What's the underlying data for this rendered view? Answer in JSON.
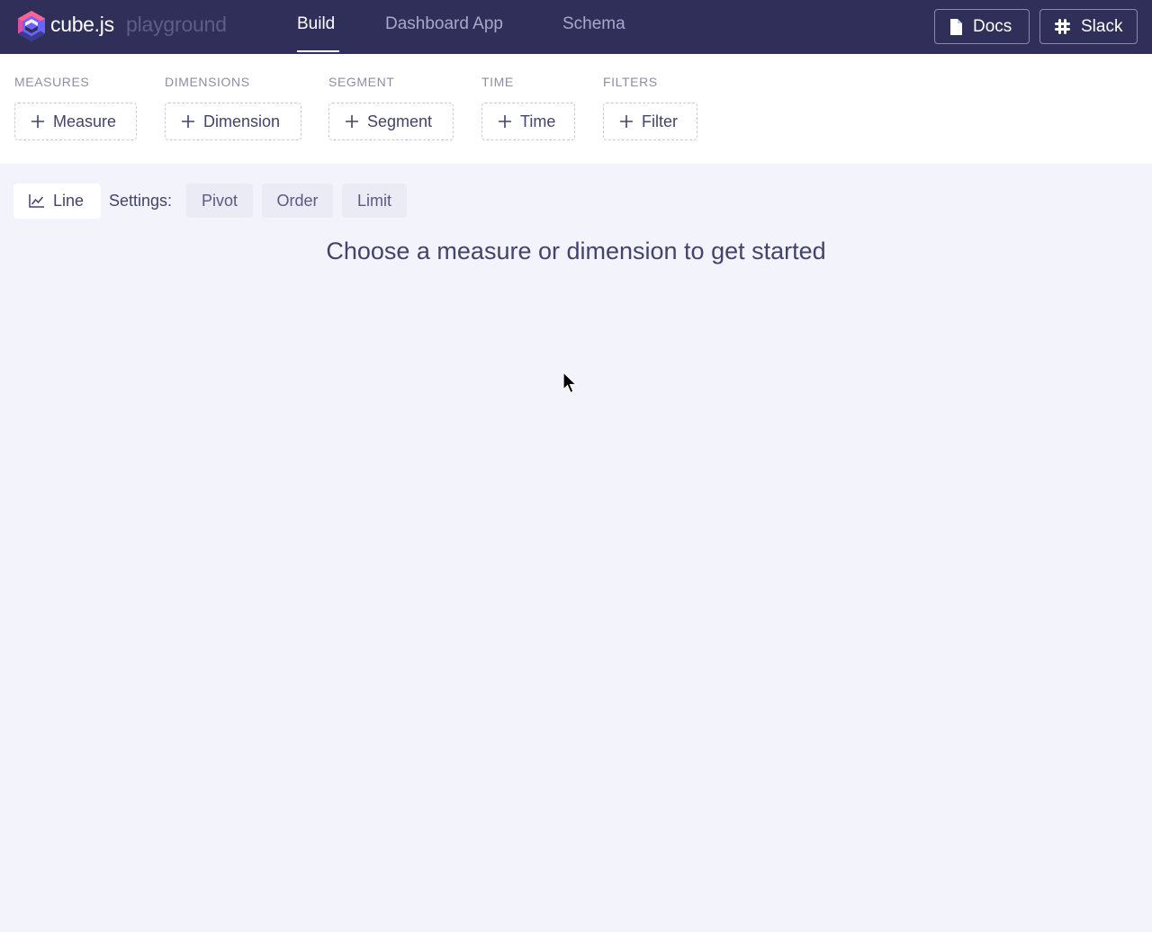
{
  "brand": {
    "name": "cube.js",
    "sub": "playground"
  },
  "nav": [
    {
      "label": "Build",
      "active": true
    },
    {
      "label": "Dashboard App",
      "active": false
    },
    {
      "label": "Schema",
      "active": false
    }
  ],
  "header_buttons": {
    "docs": "Docs",
    "slack": "Slack"
  },
  "builder": {
    "measures": {
      "label": "MEASURES",
      "button": "Measure"
    },
    "dimensions": {
      "label": "DIMENSIONS",
      "button": "Dimension"
    },
    "segment": {
      "label": "SEGMENT",
      "button": "Segment"
    },
    "time": {
      "label": "TIME",
      "button": "Time"
    },
    "filters": {
      "label": "FILTERS",
      "button": "Filter"
    }
  },
  "toolbar": {
    "chart_type": "Line",
    "settings_label": "Settings:",
    "pivot": "Pivot",
    "order": "Order",
    "limit": "Limit"
  },
  "message": "Choose a measure or dimension to get started",
  "colors": {
    "header_bg": "#2f2f59",
    "accent_pink": "#ff6492",
    "accent_purple": "#7a77ff",
    "text": "#43436b"
  },
  "icons": {
    "logo": "cube-logo-icon",
    "docs": "document-icon",
    "slack": "slack-icon",
    "add": "plus-icon",
    "chart": "line-chart-icon"
  }
}
